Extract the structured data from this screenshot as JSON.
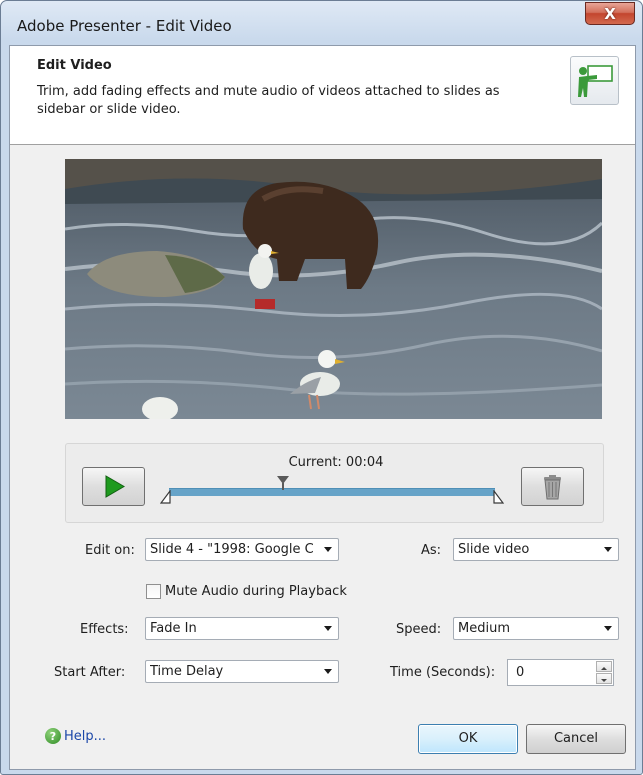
{
  "window": {
    "title": "Adobe Presenter - Edit Video",
    "close_glyph": "X"
  },
  "header": {
    "title": "Edit Video",
    "description": "Trim, add fading effects and mute audio of videos attached to slides as sidebar or slide video.",
    "icon": "presenter-slide-icon"
  },
  "player": {
    "current_label": "Current: 00:04",
    "play_icon": "play-icon",
    "delete_icon": "trash-icon",
    "accent": "#1e9a1e",
    "track_color": "#66a3c8"
  },
  "form": {
    "edit_on_label": "Edit on:",
    "edit_on_value": "Slide 4 - \"1998: Google C",
    "as_label": "As:",
    "as_value": "Slide video",
    "mute_label": "Mute Audio during Playback",
    "mute_checked": false,
    "effects_label": "Effects:",
    "effects_value": "Fade In",
    "speed_label": "Speed:",
    "speed_value": "Medium",
    "start_after_label": "Start After:",
    "start_after_value": "Time Delay",
    "time_label": "Time (Seconds):",
    "time_value": "0"
  },
  "footer": {
    "help_label": "Help...",
    "help_icon_glyph": "?",
    "ok_label": "OK",
    "cancel_label": "Cancel"
  }
}
